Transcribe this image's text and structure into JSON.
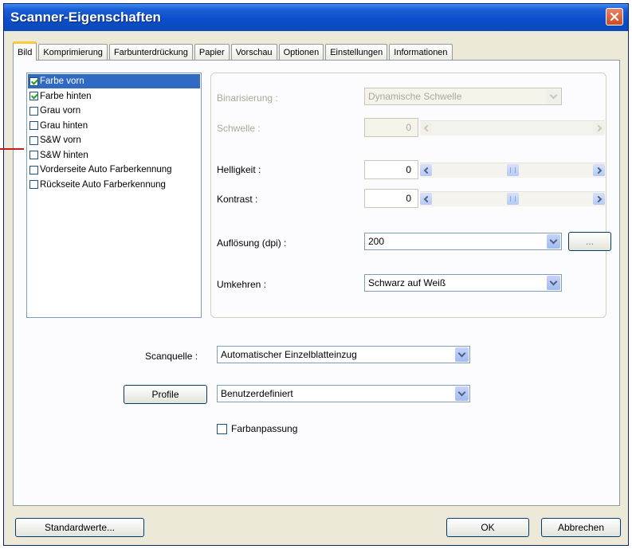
{
  "window": {
    "title": "Scanner-Eigenschaften"
  },
  "tabs": [
    "Bild",
    "Komprimierung",
    "Farbunterdrückung",
    "Papier",
    "Vorschau",
    "Optionen",
    "Einstellungen",
    "Informationen"
  ],
  "active_tab": "Bild",
  "image_list": [
    {
      "label": "Farbe vorn",
      "checked": true,
      "selected": true
    },
    {
      "label": "Farbe hinten",
      "checked": true,
      "selected": false
    },
    {
      "label": "Grau vorn",
      "checked": false,
      "selected": false
    },
    {
      "label": "Grau hinten",
      "checked": false,
      "selected": false
    },
    {
      "label": "S&W vorn",
      "checked": false,
      "selected": false
    },
    {
      "label": "S&W hinten",
      "checked": false,
      "selected": false
    },
    {
      "label": "Vorderseite Auto Farberkennung",
      "checked": false,
      "selected": false
    },
    {
      "label": "Rückseite Auto Farberkennung",
      "checked": false,
      "selected": false
    }
  ],
  "settings": {
    "binarization": {
      "label": "Binarisierung :",
      "value": "Dynamische Schwelle"
    },
    "threshold": {
      "label": "Schwelle :",
      "value": "0"
    },
    "brightness": {
      "label": "Helligkeit :",
      "value": "0",
      "level": 0.5
    },
    "contrast": {
      "label": "Kontrast :",
      "value": "0",
      "level": 0.5
    },
    "resolution": {
      "label": "Auflösung (dpi) :",
      "value": "200",
      "more_label": "..."
    },
    "invert": {
      "label": "Umkehren :",
      "value": "Schwarz auf Weiß"
    }
  },
  "scan_source": {
    "label": "Scanquelle :",
    "value": "Automatischer Einzelblatteinzug"
  },
  "profile": {
    "button_label": "Profile",
    "value": "Benutzerdefiniert"
  },
  "color_match": {
    "label": "Farbanpassung",
    "checked": false
  },
  "footer": {
    "defaults_label": "Standardwerte...",
    "ok_label": "OK",
    "cancel_label": "Abbrechen"
  },
  "colors": {
    "title_bar": "#0b4ccb",
    "selection": "#316ac5",
    "dialog": "#ece9d8",
    "annotation_line": "#c81a1a"
  }
}
